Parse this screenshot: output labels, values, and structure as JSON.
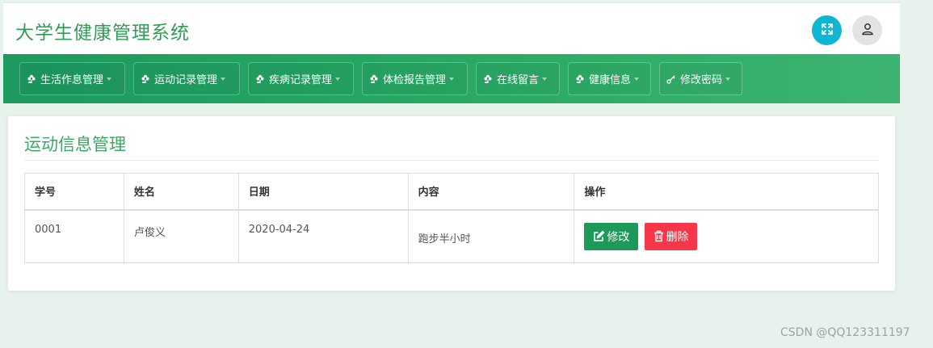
{
  "app": {
    "title": "大学生健康管理系统"
  },
  "topbar": {
    "expand_icon": "expand-arrows-icon",
    "user_icon": "user-icon"
  },
  "nav": {
    "items": [
      {
        "label": "生活作息管理",
        "icon": "flower-icon"
      },
      {
        "label": "运动记录管理",
        "icon": "flower-icon"
      },
      {
        "label": "疾病记录管理",
        "icon": "flower-icon"
      },
      {
        "label": "体检报告管理",
        "icon": "flower-icon"
      },
      {
        "label": "在线留言",
        "icon": "flower-icon"
      },
      {
        "label": "健康信息",
        "icon": "flower-icon"
      },
      {
        "label": "修改密码",
        "icon": "key-icon"
      }
    ]
  },
  "panel": {
    "title": "运动信息管理",
    "table": {
      "headers": [
        "学号",
        "姓名",
        "日期",
        "内容",
        "操作"
      ],
      "rows": [
        {
          "student_id": "0001",
          "name": "卢俊义",
          "date": "2020-04-24",
          "content": "跑步半小时"
        }
      ]
    },
    "actions": {
      "edit_label": "修改",
      "delete_label": "删除"
    }
  },
  "watermark": "CSDN @QQ123311197",
  "colors": {
    "brand": "#2f9e55",
    "nav": "#1c9a5f",
    "edit": "#1d9a5a",
    "delete": "#f7364a",
    "expand": "#0fb6d4"
  }
}
